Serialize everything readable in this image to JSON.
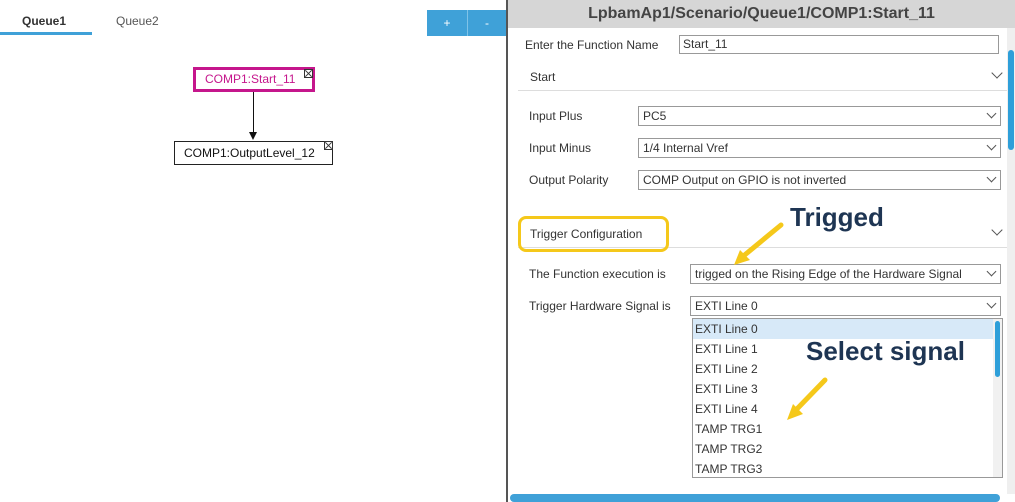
{
  "tabs": [
    "Queue1",
    "Queue2"
  ],
  "toolbar": {
    "plus_label": "+",
    "minus_label": "-"
  },
  "canvas": {
    "node1_label": "COMP1:Start_11",
    "node2_label": "COMP1:OutputLevel_12"
  },
  "panel": {
    "title": "LpbamAp1/Scenario/Queue1/COMP1:Start_11",
    "function_name_label": "Enter the Function Name",
    "function_name_value": "Start_11",
    "start_section": "Start",
    "input_plus_label": "Input Plus",
    "input_plus_value": "PC5",
    "input_minus_label": "Input Minus",
    "input_minus_value": "1/4 Internal Vref",
    "output_polarity_label": "Output Polarity",
    "output_polarity_value": "COMP Output on GPIO is not inverted",
    "trigger_section": "Trigger Configuration",
    "func_exec_label": "The Function execution is",
    "func_exec_value": "trigged on the Rising Edge of the Hardware Signal",
    "trigger_hw_label": "Trigger Hardware Signal is",
    "trigger_hw_value": "EXTI Line 0",
    "dropdown_options": [
      "EXTI Line 0",
      "EXTI Line 1",
      "EXTI Line 2",
      "EXTI Line 3",
      "EXTI Line 4",
      "TAMP TRG1",
      "TAMP TRG2",
      "TAMP TRG3"
    ]
  },
  "annotations": {
    "trigged": "Trigged",
    "select_signal": "Select signal"
  },
  "colors": {
    "accent": "#3fa1d8",
    "node_highlight": "#c5168c",
    "callout_yellow": "#f5c81a",
    "callout_text": "#1e3553"
  }
}
